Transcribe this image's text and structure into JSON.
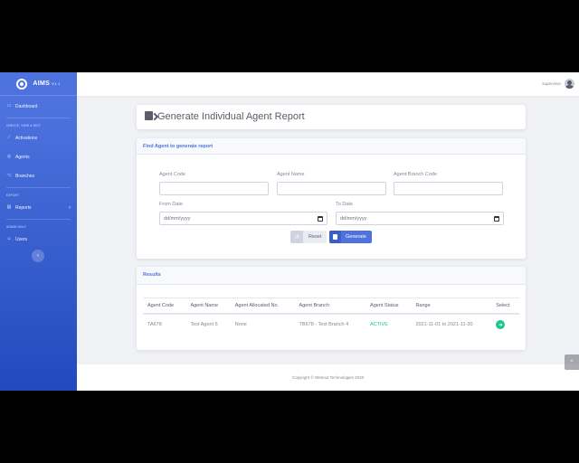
{
  "brand": {
    "name": "AIMS",
    "version": "V1.1"
  },
  "sidebar": {
    "dashboard": "Dashboard",
    "heading_create": "CREATE, VIEW & EDIT",
    "activations": "Activations",
    "agents": "Agents",
    "branches": "Branches",
    "heading_export": "EXPORT",
    "reports": "Reports",
    "heading_admin": "ADMIN ONLY",
    "users": "Users"
  },
  "topbar": {
    "user": "supervisor"
  },
  "page": {
    "title": "Generate Individual Agent Report"
  },
  "form": {
    "header": "Find Agent to generate report",
    "agent_code_label": "Agent Code",
    "agent_name_label": "Agent Name",
    "agent_branch_code_label": "Agent Branch Code",
    "from_date_label": "From Date",
    "from_date_value": "dd/mm/yyyy",
    "to_date_label": "To Date",
    "to_date_value": "dd/mm/yyyy",
    "reset_label": "Reset",
    "generate_label": "Generate"
  },
  "results": {
    "header": "Results",
    "columns": [
      "Agent Code",
      "Agent Name",
      "Agent Allocated No.",
      "Agent Branch",
      "Agent Status",
      "Range",
      "Select"
    ],
    "rows": [
      {
        "code": "TA678",
        "name": "Test Agent 5",
        "allocated": "None",
        "branch": "TB678 - Test Branch 4",
        "status": "ACTIVE",
        "range": "2021-11-01 to 2021-11-30"
      }
    ]
  },
  "footer": {
    "text": "Copyright © Webout Technologies 2020"
  },
  "colors": {
    "primary": "#4e73df",
    "success": "#1cc88a"
  }
}
